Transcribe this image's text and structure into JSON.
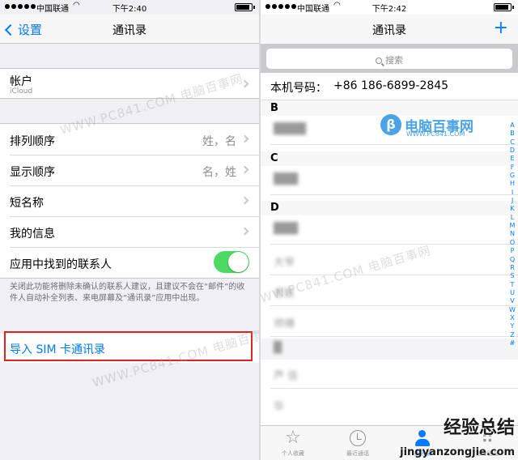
{
  "left": {
    "status": {
      "carrier": "中国联通",
      "wifi": "WiFi",
      "time": "下午2:40"
    },
    "nav": {
      "back_label": "设置",
      "title": "通讯录"
    },
    "account": {
      "label": "帐户",
      "sub": "iCloud"
    },
    "rows": [
      {
        "label": "排列顺序",
        "value": "姓，名"
      },
      {
        "label": "显示顺序",
        "value": "名，姓"
      },
      {
        "label": "短名称",
        "value": ""
      },
      {
        "label": "我的信息",
        "value": ""
      },
      {
        "label": "应用中找到的联系人",
        "toggle": true
      }
    ],
    "footnote": "关闭此功能将删除未确认的联系人建议，且建议不会在“邮件”的收件人自动补全列表、来电屏幕及“通讯录”应用中出现。",
    "sim_import": "导入 SIM 卡通讯录",
    "colors": {
      "accent": "#007aff",
      "toggle_on": "#4cd964",
      "highlight_box": "#e0211d"
    }
  },
  "right": {
    "status": {
      "carrier": "中国联通",
      "wifi": "WiFi",
      "time": "下午2:42"
    },
    "nav": {
      "title": "通讯录",
      "add_icon": "+"
    },
    "search_placeholder": "搜索",
    "my_number": {
      "label": "本机号码：",
      "value": "+86 186-6899-2845"
    },
    "sections": [
      {
        "letter": "B",
        "contacts": [
          "████"
        ]
      },
      {
        "letter": "C",
        "contacts": [
          "███"
        ]
      },
      {
        "letter": "D",
        "contacts": [
          "███",
          "大爷",
          "老板",
          "师傅",
          "█",
          "芦  信",
          "华  "
        ]
      }
    ],
    "index_letters": [
      "A",
      "B",
      "C",
      "D",
      "E",
      "F",
      "G",
      "H",
      "I",
      "J",
      "K",
      "L",
      "M",
      "N",
      "O",
      "P",
      "Q",
      "R",
      "S",
      "T",
      "U",
      "V",
      "W",
      "X",
      "Y",
      "Z",
      "#"
    ],
    "tabs": [
      {
        "label": "个人收藏",
        "icon": "star-icon"
      },
      {
        "label": "最近通话",
        "icon": "clock-icon"
      },
      {
        "label": "通讯录",
        "icon": "person-icon",
        "active": true
      },
      {
        "label": "拨号键盘",
        "icon": "keypad-icon"
      }
    ]
  },
  "watermarks": {
    "text": "WWW.PC841.COM 电脑百事网",
    "logo": "电脑百事网",
    "logo_sub": "WWW.PC841.COM",
    "site": "经验总结",
    "site_url": "jingyanzongjie.com"
  }
}
